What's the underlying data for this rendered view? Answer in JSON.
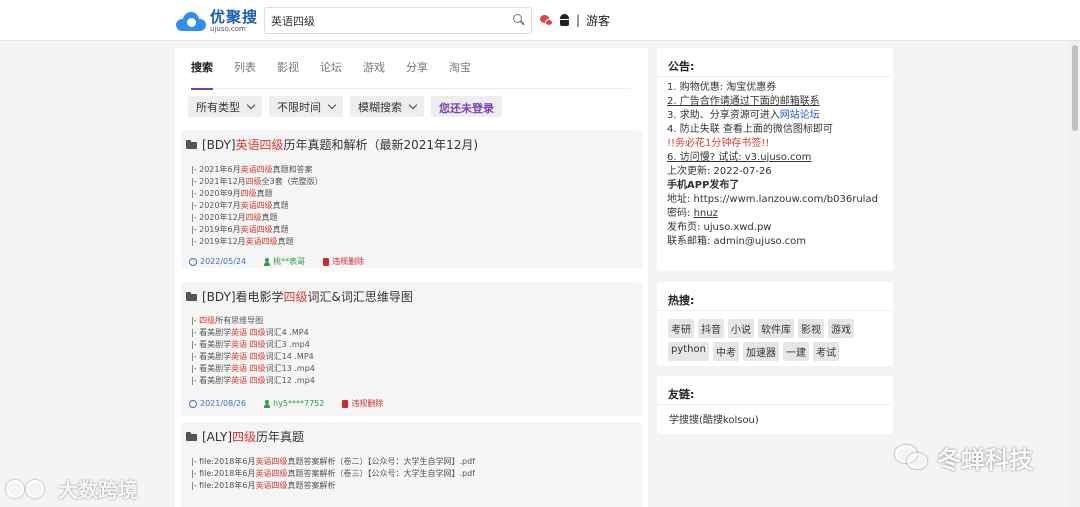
{
  "header": {
    "logo_main": "优聚搜",
    "logo_sub": "ujuso.com",
    "search_value": "英语四级",
    "separator": "|",
    "guest": "游客"
  },
  "tabs": [
    "搜索",
    "列表",
    "影视",
    "论坛",
    "游戏",
    "分享",
    "淘宝"
  ],
  "filters": {
    "type": "所有类型",
    "time": "不限时间",
    "mode": "模糊搜索",
    "login": "您还未登录"
  },
  "results": [
    {
      "title": [
        {
          "t": "[BDY]",
          "hl": false
        },
        {
          "t": "英语四级",
          "hl": true
        },
        {
          "t": "历年真题和解析（最新2021年12月)",
          "hl": false
        }
      ],
      "files": [
        [
          {
            "t": "|- 2021年6月",
            "hl": false
          },
          {
            "t": "英语四级",
            "hl": true
          },
          {
            "t": "真题和答案",
            "hl": false
          }
        ],
        [
          {
            "t": "|- 2021年12月",
            "hl": false
          },
          {
            "t": "四级",
            "hl": true
          },
          {
            "t": "全3套（完整版）",
            "hl": false
          }
        ],
        [
          {
            "t": "|- 2020年9月",
            "hl": false
          },
          {
            "t": "四级",
            "hl": true
          },
          {
            "t": "真题",
            "hl": false
          }
        ],
        [
          {
            "t": "|- 2020年7月",
            "hl": false
          },
          {
            "t": "英语四级",
            "hl": true
          },
          {
            "t": "真题",
            "hl": false
          }
        ],
        [
          {
            "t": "|- 2020年12月",
            "hl": false
          },
          {
            "t": "四级",
            "hl": true
          },
          {
            "t": "真题",
            "hl": false
          }
        ],
        [
          {
            "t": "|- 2019年6月",
            "hl": false
          },
          {
            "t": "英语四级",
            "hl": true
          },
          {
            "t": "真题",
            "hl": false
          }
        ],
        [
          {
            "t": "|- 2019年12月",
            "hl": false
          },
          {
            "t": "英语四级",
            "hl": true
          },
          {
            "t": "真题",
            "hl": false
          }
        ]
      ],
      "date": "2022/05/24",
      "user": "桃**表哥",
      "report": "违规删除"
    },
    {
      "title": [
        {
          "t": "[BDY]看电影学",
          "hl": false
        },
        {
          "t": "四级",
          "hl": true
        },
        {
          "t": "词汇&词汇思维导图",
          "hl": false
        }
      ],
      "files": [
        [
          {
            "t": "|- ",
            "hl": false
          },
          {
            "t": "四级",
            "hl": true
          },
          {
            "t": "所有思维导图",
            "hl": false
          }
        ],
        [
          {
            "t": "|- 看美剧学",
            "hl": false
          },
          {
            "t": "英语 四级",
            "hl": true
          },
          {
            "t": "词汇4 .MP4",
            "hl": false
          }
        ],
        [
          {
            "t": "|- 看美剧学",
            "hl": false
          },
          {
            "t": "英语 四级",
            "hl": true
          },
          {
            "t": "词汇3 .mp4",
            "hl": false
          }
        ],
        [
          {
            "t": "|- 看美剧学",
            "hl": false
          },
          {
            "t": "英语 四级",
            "hl": true
          },
          {
            "t": "词汇14 .MP4",
            "hl": false
          }
        ],
        [
          {
            "t": "|- 看美剧学",
            "hl": false
          },
          {
            "t": "英语 四级",
            "hl": true
          },
          {
            "t": "词汇13 .mp4",
            "hl": false
          }
        ],
        [
          {
            "t": "|- 看美剧学",
            "hl": false
          },
          {
            "t": "英语 四级",
            "hl": true
          },
          {
            "t": "词汇12 .mp4",
            "hl": false
          }
        ]
      ],
      "date": "2021/08/26",
      "user": "hy5****7752",
      "report": "违规删除"
    },
    {
      "title": [
        {
          "t": "[ALY]",
          "hl": false
        },
        {
          "t": "四级",
          "hl": true
        },
        {
          "t": "历年真题",
          "hl": false
        }
      ],
      "files": [
        [
          {
            "t": "|- file:2018年6月",
            "hl": false
          },
          {
            "t": "英语四级",
            "hl": true
          },
          {
            "t": "真题答案解析（卷二）【公众号：大学生自学网】.pdf",
            "hl": false
          }
        ],
        [
          {
            "t": "|- file:2018年6月",
            "hl": false
          },
          {
            "t": "英语四级",
            "hl": true
          },
          {
            "t": "真题答案解析（卷三）【公众号：大学生自学网】.pdf",
            "hl": false
          }
        ],
        [
          {
            "t": "|- file:2018年6月",
            "hl": false
          },
          {
            "t": "英语四级",
            "hl": true
          },
          {
            "t": "真题答案解析",
            "hl": false
          }
        ]
      ]
    }
  ],
  "notice": {
    "heading": "公告:",
    "line1": "1. 购物优惠: 淘宝优惠券",
    "line2": "2. 广告合作请通过下面的邮箱联系",
    "line3_a": "3. 求助、分享资源可进入",
    "line3_b": "网站论坛",
    "line4": "4. 防止失联 查看上面的微信图标即可",
    "line5": "!!务必花1分钟存书签!!",
    "line6": "6. 访问慢? 试试: v3.ujuso.com",
    "updated": "上次更新: 2022-07-26",
    "app_heading": "手机APP发布了",
    "app_addr": "地址: https://wwm.lanzouw.com/b036rulad",
    "pwd_label": "密码:",
    "pwd_value": "hnuz",
    "publish": "发布页: ujuso.xwd.pw",
    "email": "联系邮箱: admin@ujuso.com"
  },
  "hot": {
    "heading": "热搜:",
    "tags": [
      "考研",
      "抖音",
      "小说",
      "软件库",
      "影视",
      "游戏",
      "python",
      "中考",
      "加速器",
      "一建",
      "考试"
    ]
  },
  "links": {
    "heading": "友链:",
    "items": [
      "学搜搜(酷搜kolsou)"
    ]
  },
  "watermarks": {
    "left": "大数跨境",
    "right": "冬蝉科技"
  }
}
